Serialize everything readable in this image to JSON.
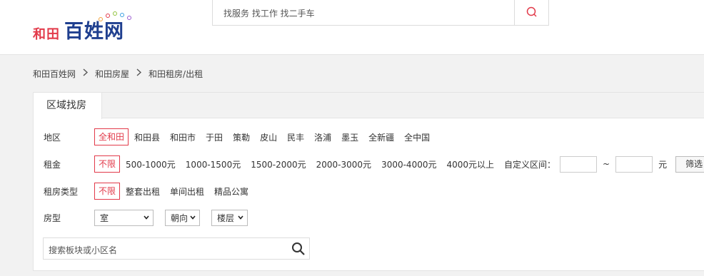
{
  "header": {
    "logo_city": "和田",
    "logo_brand": "百姓网",
    "search_placeholder": "找服务 找工作 找二手车"
  },
  "breadcrumb": [
    "和田百姓网",
    "和田房屋",
    "和田租房/出租"
  ],
  "tab": "区域找房",
  "filters": {
    "region": {
      "label": "地区",
      "options": [
        "全和田",
        "和田县",
        "和田市",
        "于田",
        "策勒",
        "皮山",
        "民丰",
        "洛浦",
        "墨玉",
        "全新疆",
        "全中国"
      ]
    },
    "rent": {
      "label": "租金",
      "options": [
        "不限",
        "500-1000元",
        "1000-1500元",
        "1500-2000元",
        "2000-3000元",
        "3000-4000元",
        "4000元以上"
      ],
      "custom_label": "自定义区间：",
      "tilde": "~",
      "unit": "元",
      "filter_button": "筛选"
    },
    "type": {
      "label": "租房类型",
      "options": [
        "不限",
        "整套出租",
        "单间出租",
        "精品公寓"
      ]
    },
    "layout": {
      "label": "房型",
      "room_select": "室",
      "orientation_select": "朝向",
      "floor_select": "楼层"
    }
  },
  "keyword_search_placeholder": "搜索板块或小区名",
  "colors": {
    "accent": "#e23a4a",
    "brand": "#1f3f8f"
  }
}
